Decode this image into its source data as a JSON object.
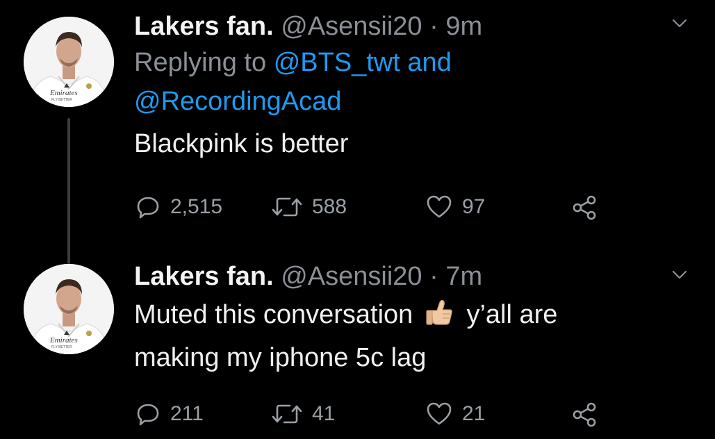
{
  "tweets": [
    {
      "name": "Lakers fan.",
      "handle": "@Asensii20",
      "separator": "·",
      "time": "9m",
      "replying_prefix": "Replying to",
      "reply_mention_1": "@BTS_twt",
      "reply_and": "and",
      "reply_mention_2": "@RecordingAcad",
      "text": "Blackpink is better",
      "replies": "2,515",
      "retweets": "588",
      "likes": "97"
    },
    {
      "name": "Lakers fan.",
      "handle": "@Asensii20",
      "separator": "·",
      "time": "7m",
      "text_part1": "Muted this conversation",
      "emoji": "thumbs-up",
      "text_part2": "y’all are",
      "text_line2": "making my iphone 5c lag",
      "replies": "211",
      "retweets": "41",
      "likes": "21"
    }
  ],
  "avatar": {
    "jersey_text": "Emirates",
    "jersey_subtext": "FLY BETTER"
  },
  "colors": {
    "background": "#000000",
    "text": "#e7e9ea",
    "muted": "#8b9096",
    "link": "#1d9bf0",
    "thread_line": "#3a3d40"
  },
  "icons": [
    "chevron-down-icon",
    "reply-icon",
    "retweet-icon",
    "like-icon",
    "share-icon"
  ]
}
